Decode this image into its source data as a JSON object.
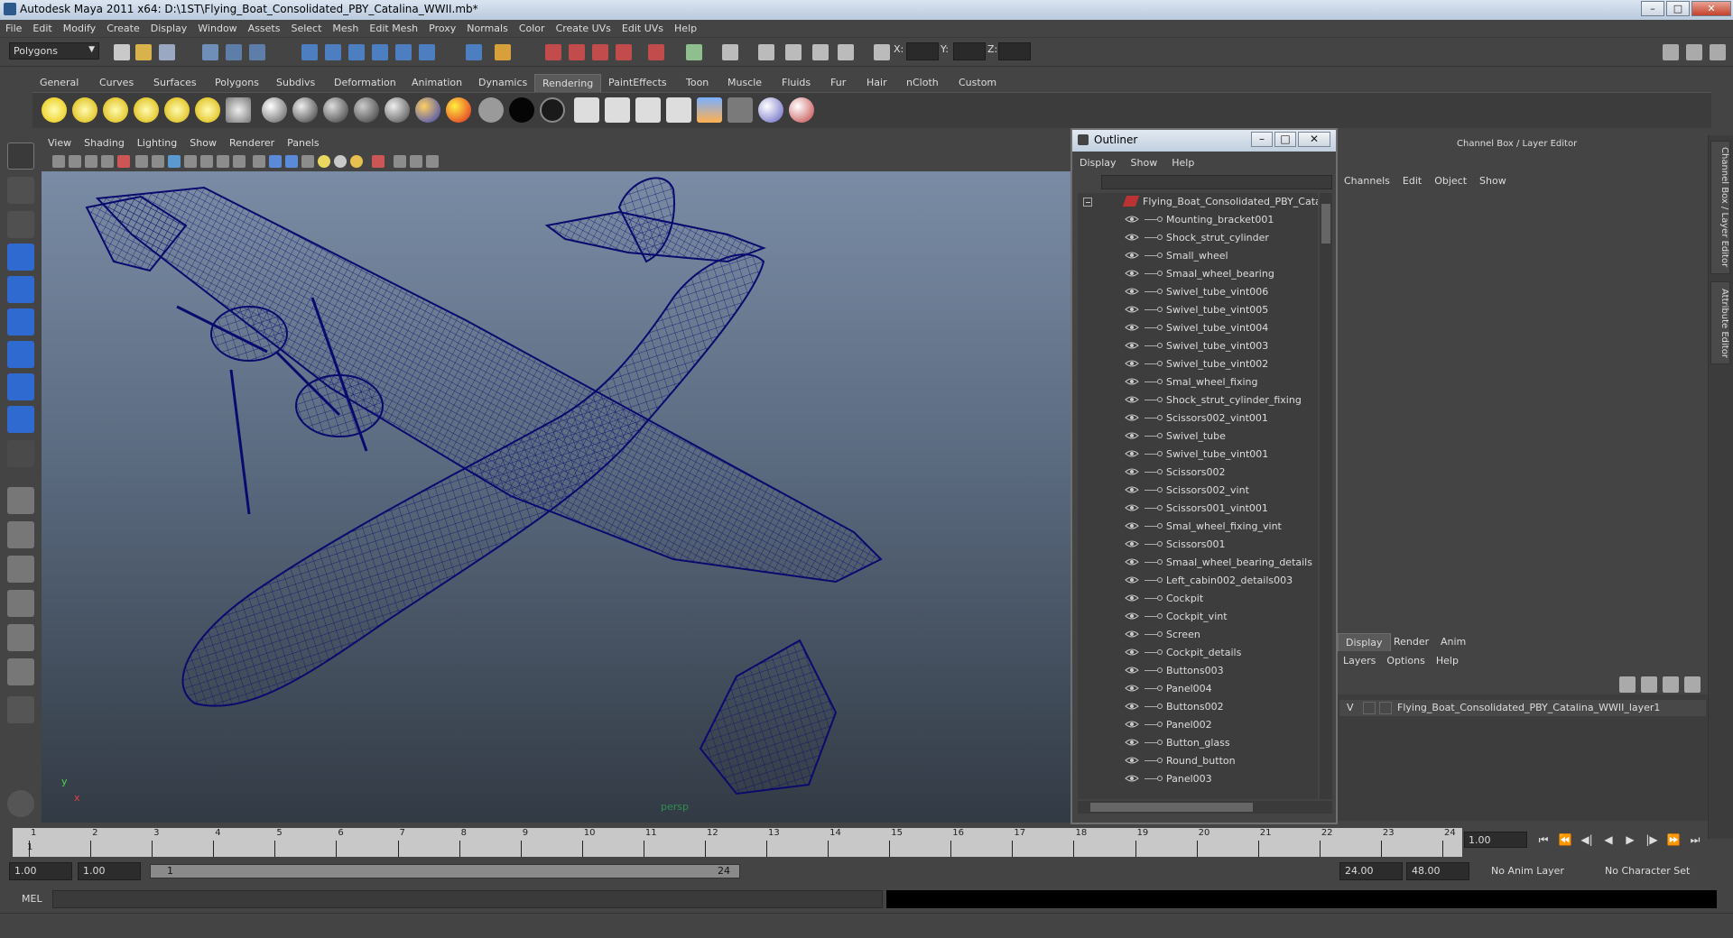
{
  "window": {
    "title": "Autodesk Maya 2011 x64: D:\\1ST\\Flying_Boat_Consolidated_PBY_Catalina_WWII.mb*",
    "minimize": "–",
    "maximize": "□",
    "close": "✕"
  },
  "menubar": [
    "File",
    "Edit",
    "Modify",
    "Create",
    "Display",
    "Window",
    "Assets",
    "Select",
    "Mesh",
    "Edit Mesh",
    "Proxy",
    "Normals",
    "Color",
    "Create UVs",
    "Edit UVs",
    "Help"
  ],
  "status": {
    "mode": "Polygons",
    "x_label": "X:",
    "y_label": "Y:",
    "z_label": "Z:"
  },
  "shelf": {
    "tabs": [
      "General",
      "Curves",
      "Surfaces",
      "Polygons",
      "Subdivs",
      "Deformation",
      "Animation",
      "Dynamics",
      "Rendering",
      "PaintEffects",
      "Toon",
      "Muscle",
      "Fluids",
      "Fur",
      "Hair",
      "nCloth",
      "Custom"
    ],
    "active": "Rendering"
  },
  "panel": {
    "menus": [
      "View",
      "Shading",
      "Lighting",
      "Show",
      "Renderer",
      "Panels"
    ],
    "camera_label": "persp",
    "axis_y": "y",
    "axis_x": "x"
  },
  "outliner": {
    "title": "Outliner",
    "menus": [
      "Display",
      "Show",
      "Help"
    ],
    "root": "Flying_Boat_Consolidated_PBY_Catalin",
    "items": [
      "Mounting_bracket001",
      "Shock_strut_cylinder",
      "Small_wheel",
      "Smaal_wheel_bearing",
      "Swivel_tube_vint006",
      "Swivel_tube_vint005",
      "Swivel_tube_vint004",
      "Swivel_tube_vint003",
      "Swivel_tube_vint002",
      "Smal_wheel_fixing",
      "Shock_strut_cylinder_fixing",
      "Scissors002_vint001",
      "Swivel_tube",
      "Swivel_tube_vint001",
      "Scissors002",
      "Scissors002_vint",
      "Scissors001_vint001",
      "Smal_wheel_fixing_vint",
      "Scissors001",
      "Smaal_wheel_bearing_details",
      "Left_cabin002_details003",
      "Cockpit",
      "Cockpit_vint",
      "Screen",
      "Cockpit_details",
      "Buttons003",
      "Panel004",
      "Buttons002",
      "Panel002",
      "Button_glass",
      "Round_button",
      "Panel003"
    ]
  },
  "channelbox": {
    "title": "Channel Box / Layer Editor",
    "menus": [
      "Channels",
      "Edit",
      "Object",
      "Show"
    ],
    "side_tabs": [
      "Channel Box / Layer Editor",
      "Attribute Editor"
    ]
  },
  "layers": {
    "tabs": [
      "Display",
      "Render",
      "Anim"
    ],
    "active": "Display",
    "menus": [
      "Layers",
      "Options",
      "Help"
    ],
    "row_v": "V",
    "layer_name": "Flying_Boat_Consolidated_PBY_Catalina_WWII_layer1"
  },
  "timeline": {
    "ticks": [
      "1",
      "2",
      "3",
      "4",
      "5",
      "6",
      "7",
      "8",
      "9",
      "10",
      "11",
      "12",
      "13",
      "14",
      "15",
      "16",
      "17",
      "18",
      "19",
      "20",
      "21",
      "22",
      "23",
      "24"
    ],
    "marker": "1",
    "current_frame": "1.00"
  },
  "range": {
    "start": "1.00",
    "start_inner": "1.00",
    "slider_left": "1",
    "slider_right": "24",
    "end_inner": "24.00",
    "end": "48.00",
    "anim_layer": "No Anim Layer",
    "char_set": "No Character Set"
  },
  "cmd": {
    "label": "MEL"
  },
  "colors": {
    "wire": "#0a0a6e",
    "accent": "#5a5a5a"
  }
}
